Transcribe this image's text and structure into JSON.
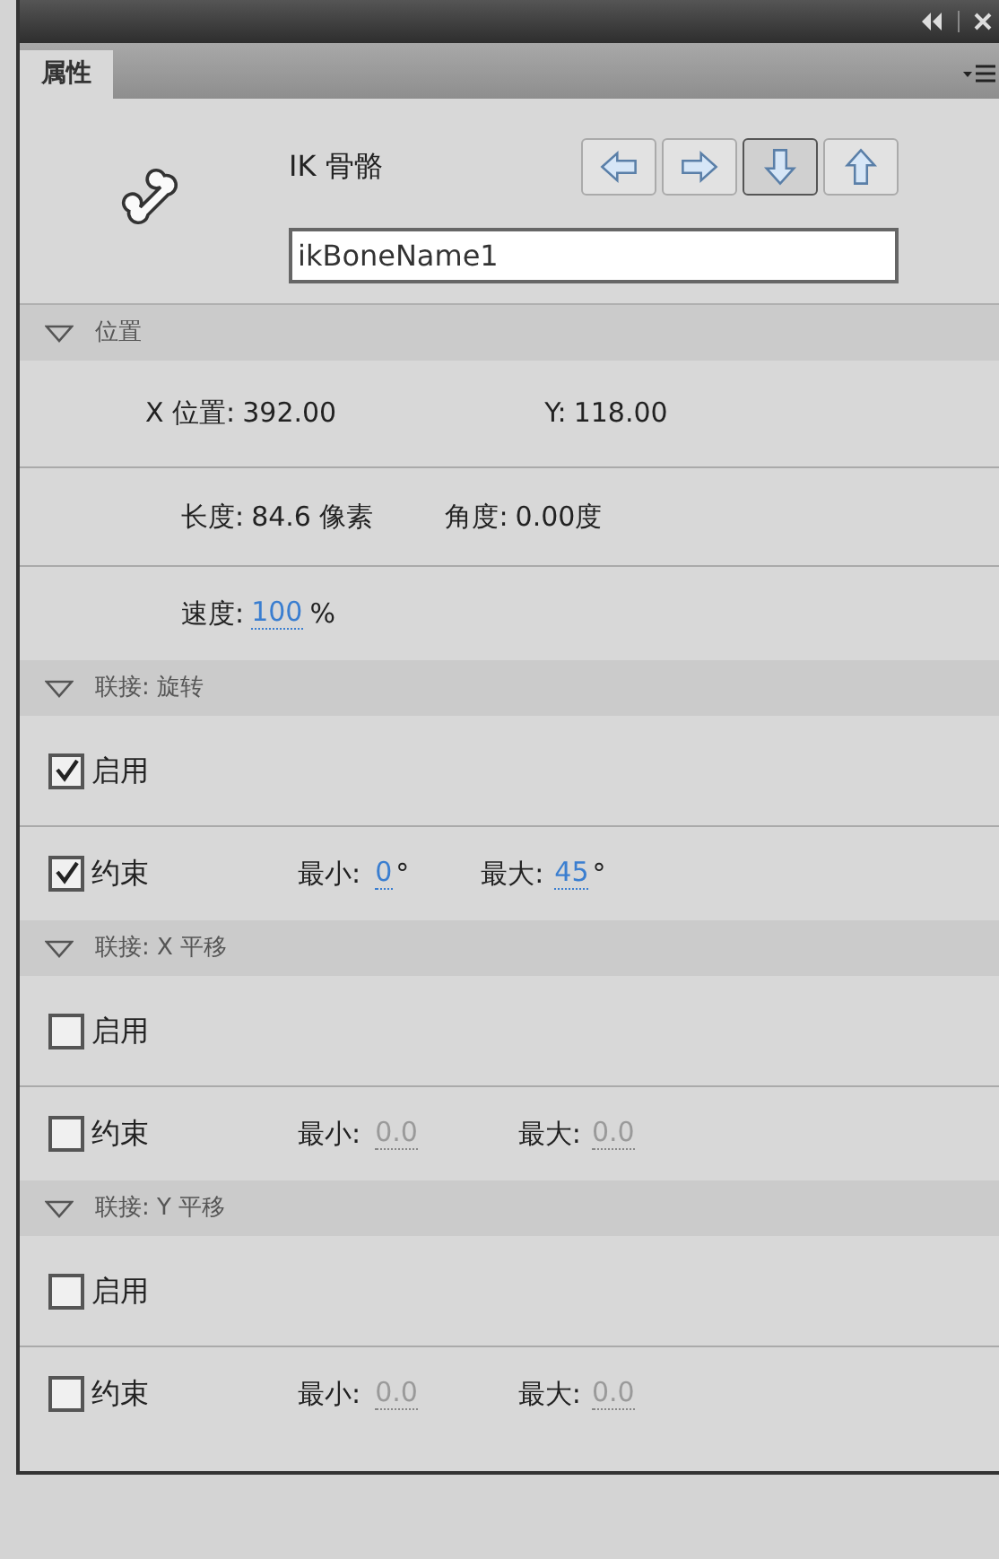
{
  "tabs": [
    {
      "label": "属性",
      "selected": true
    }
  ],
  "header": {
    "title": "IK 骨骼",
    "name_value": "ikBoneName1",
    "nav_buttons": [
      {
        "kind": "left",
        "selected": false
      },
      {
        "kind": "right",
        "selected": false
      },
      {
        "kind": "down",
        "selected": true
      },
      {
        "kind": "up",
        "selected": false
      }
    ]
  },
  "position": {
    "title": "位置",
    "expanded": true,
    "x_label": "X 位置:",
    "x_value": "392.00",
    "y_label": "Y:",
    "y_value": "118.00",
    "length_label": "长度:",
    "length_value": "84.6 像素",
    "angle_label": "角度:",
    "angle_value": "0.00度",
    "speed_label": "速度:",
    "speed_value": "100",
    "speed_unit": "%"
  },
  "joints": [
    {
      "title": "联接: 旋转",
      "expanded": true,
      "enable": {
        "label": "启用",
        "checked": true
      },
      "constrain": {
        "label": "约束",
        "checked": true
      },
      "min_label": "最小:",
      "min_value": "0",
      "min_unit": "°",
      "max_label": "最大:",
      "max_value": "45",
      "max_unit": "°"
    },
    {
      "title": "联接: X 平移",
      "expanded": true,
      "enable": {
        "label": "启用",
        "checked": false
      },
      "constrain": {
        "label": "约束",
        "checked": false
      },
      "min_label": "最小:",
      "min_value": "0.0",
      "max_label": "最大:",
      "max_value": "0.0"
    },
    {
      "title": "联接: Y 平移",
      "expanded": true,
      "enable": {
        "label": "启用",
        "checked": false
      },
      "constrain": {
        "label": "约束",
        "checked": false
      },
      "min_label": "最小:",
      "min_value": "0.0",
      "max_label": "最大:",
      "max_value": "0.0"
    }
  ]
}
